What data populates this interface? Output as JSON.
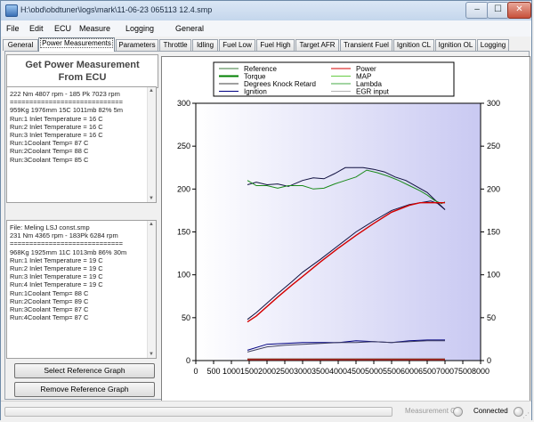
{
  "window": {
    "title": "H:\\obd\\obdtuner\\logs\\mark\\11-06-23 065113 12.4.smp",
    "min_glyph": "–",
    "max_glyph": "☐",
    "close_glyph": "✕"
  },
  "menu": [
    "File",
    "Edit",
    "ECU",
    "Measure",
    "Logging",
    "General"
  ],
  "tabs": [
    {
      "label": "General",
      "active": false
    },
    {
      "label": "Power Measurements",
      "active": true
    },
    {
      "label": "Parameters",
      "active": false
    },
    {
      "label": "Throttle",
      "active": false
    },
    {
      "label": "Idling",
      "active": false
    },
    {
      "label": "Fuel Low",
      "active": false
    },
    {
      "label": "Fuel High",
      "active": false
    },
    {
      "label": "Target AFR",
      "active": false
    },
    {
      "label": "Transient Fuel",
      "active": false
    },
    {
      "label": "Ignition CL",
      "active": false
    },
    {
      "label": "Ignition OL",
      "active": false
    },
    {
      "label": "Logging",
      "active": false
    }
  ],
  "left": {
    "heading_line1": "Get Power Measurement",
    "heading_line2": "From ECU",
    "current_log": [
      "222 Nm 4807 rpm - 185 Pk 7023 rpm",
      "=============================",
      "959Kg 1976mm 15C 1011mb 82% 5m",
      "Run:1 Inlet Temperature = 16 C",
      "Run:2 Inlet Temperature = 16 C",
      "Run:3 Inlet Temperature = 16 C",
      "Run:1Coolant Temp= 87 C",
      "Run:2Coolant Temp= 88 C",
      "Run:3Coolant Temp= 85 C"
    ],
    "reference_log": [
      "File: Meling LSJ const.smp",
      "231 Nm 4365 rpm - 183Pk 6284 rpm",
      "=============================",
      "968Kg 1925mm 11C 1013mb 86% 30m",
      "Run:1 Inlet Temperature = 19 C",
      "Run:2 Inlet Temperature = 19 C",
      "Run:3 Inlet Temperature = 19 C",
      "Run:4 Inlet Temperature = 19 C",
      "Run:1Coolant Temp= 88 C",
      "Run:2Coolant Temp= 89 C",
      "Run:3Coolant Temp= 87 C",
      "Run:4Coolant Temp= 87 C"
    ],
    "select_ref_button": "Select Reference Graph",
    "remove_ref_button": "Remove Reference Graph"
  },
  "chart_data": {
    "type": "line",
    "legend_placement": "top",
    "xlim": [
      0,
      8000
    ],
    "ylim": [
      0,
      300
    ],
    "x_ticks": [
      "0",
      "500",
      "1000",
      "1500",
      "2000",
      "2500",
      "3000",
      "3500",
      "4000",
      "4500",
      "5000",
      "5500",
      "6000",
      "6500",
      "7000",
      "7500",
      "8000"
    ],
    "y_ticks": [
      "0",
      "50",
      "100",
      "150",
      "200",
      "250",
      "300"
    ],
    "legend": [
      {
        "name": "Reference",
        "color": "#3a7a3a",
        "weight": 1
      },
      {
        "name": "Power",
        "color": "#d40000",
        "weight": 1
      },
      {
        "name": "Torque",
        "color": "#008000",
        "weight": 2
      },
      {
        "name": "MAP",
        "color": "#66cc44",
        "weight": 1
      },
      {
        "name": "Degrees Knock Retard",
        "color": "#404040",
        "weight": 1
      },
      {
        "name": "Lambda",
        "color": "#44aa44",
        "weight": 1
      },
      {
        "name": "Ignition",
        "color": "#000080",
        "weight": 1
      },
      {
        "name": "EGR input",
        "color": "#b0b0b0",
        "weight": 1
      }
    ],
    "series": [
      {
        "name": "Reference",
        "role": "torque-ref",
        "color": "#101040",
        "x": [
          1450,
          1700,
          2000,
          2300,
          2600,
          3000,
          3300,
          3600,
          3900,
          4200,
          4400,
          4700,
          5000,
          5300,
          5600,
          5900,
          6200,
          6500,
          6700,
          6900,
          7000
        ],
        "y": [
          205,
          208,
          205,
          206,
          203,
          210,
          213,
          212,
          218,
          225,
          225,
          225,
          223,
          220,
          214,
          210,
          203,
          196,
          188,
          180,
          176
        ]
      },
      {
        "name": "Torque",
        "color": "#1a8a1a",
        "x": [
          1450,
          1700,
          2000,
          2300,
          2600,
          3000,
          3300,
          3600,
          3900,
          4200,
          4500,
          4800,
          5100,
          5400,
          5700,
          6000,
          6300,
          6500,
          6700,
          6900,
          7000
        ],
        "y": [
          210,
          204,
          204,
          201,
          204,
          204,
          200,
          201,
          206,
          210,
          214,
          222,
          219,
          215,
          210,
          204,
          198,
          193,
          187,
          183,
          185
        ]
      },
      {
        "name": "Reference",
        "role": "power-ref",
        "color": "#101040",
        "x": [
          1450,
          1700,
          2000,
          2300,
          2700,
          3000,
          3500,
          4000,
          4500,
          5000,
          5500,
          6000,
          6300,
          6600,
          6800,
          7000
        ],
        "y": [
          48,
          56,
          67,
          78,
          92,
          103,
          118,
          134,
          150,
          163,
          175,
          182,
          184,
          186,
          183,
          176
        ]
      },
      {
        "name": "Power",
        "color": "#d40000",
        "x": [
          1450,
          1700,
          2000,
          2300,
          2700,
          3000,
          3500,
          4000,
          4500,
          5000,
          5500,
          6000,
          6300,
          6600,
          6800,
          7000
        ],
        "y": [
          45,
          52,
          63,
          74,
          88,
          98,
          115,
          131,
          146,
          160,
          173,
          181,
          184,
          184,
          184,
          184
        ]
      },
      {
        "name": "Ignition",
        "color": "#000080",
        "x": [
          1450,
          2000,
          2500,
          3000,
          3500,
          4000,
          4500,
          5000,
          5500,
          6000,
          6500,
          7000
        ],
        "y": [
          12,
          19,
          20,
          21,
          21,
          21,
          23,
          22,
          21,
          23,
          24,
          24
        ]
      },
      {
        "name": "Reference",
        "role": "ignition-ref",
        "color": "#404060",
        "x": [
          1450,
          2000,
          2500,
          3000,
          3500,
          4000,
          4500,
          5000,
          5500,
          6000,
          6500,
          7000
        ],
        "y": [
          10,
          16,
          18,
          19,
          20,
          21,
          21,
          22,
          21,
          22,
          23,
          23
        ]
      },
      {
        "name": "Degrees Knock Retard",
        "color": "#6b4b2a",
        "x": [
          1450,
          7000
        ],
        "y": [
          2,
          2
        ]
      },
      {
        "name": "EGR input",
        "color": "#b02020",
        "x": [
          1450,
          7000
        ],
        "y": [
          1,
          1
        ]
      }
    ]
  },
  "status": {
    "measurement": "Measurement Off",
    "connected": "Connected",
    "grip": "⋰"
  }
}
